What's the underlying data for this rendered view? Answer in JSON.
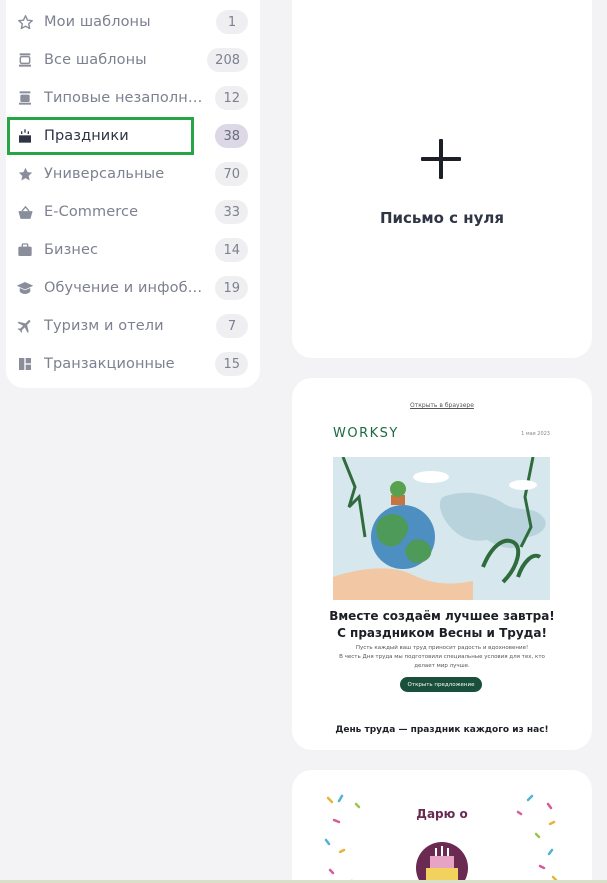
{
  "sidebar": {
    "items": [
      {
        "label": "Мои шаблоны",
        "count": "1",
        "icon": "star-outline-icon"
      },
      {
        "label": "Все шаблоны",
        "count": "208",
        "icon": "layers-icon"
      },
      {
        "label": "Типовые незаполнен...",
        "count": "12",
        "icon": "blank-template-icon"
      },
      {
        "label": "Праздники",
        "count": "38",
        "icon": "cake-icon"
      },
      {
        "label": "Универсальные",
        "count": "70",
        "icon": "star-icon"
      },
      {
        "label": "E-Commerce",
        "count": "33",
        "icon": "basket-icon"
      },
      {
        "label": "Бизнес",
        "count": "14",
        "icon": "briefcase-icon"
      },
      {
        "label": "Обучение и инфобиз...",
        "count": "19",
        "icon": "graduation-cap-icon"
      },
      {
        "label": "Туризм и отели",
        "count": "7",
        "icon": "airplane-icon"
      },
      {
        "label": "Транзакционные",
        "count": "15",
        "icon": "layout-icon"
      }
    ],
    "active_index": 3,
    "highlight_color": "#27a545"
  },
  "new_letter": {
    "label": "Письмо с нуля",
    "icon": "plus-icon"
  },
  "template_preview": {
    "open_link": "Открыть в браузере",
    "logo": "WORKSY",
    "date": "1 мая 2023",
    "headline_line1": "Вместе создаём лучшее завтра!",
    "headline_line2": "С праздником Весны и Труда!",
    "text_line1": "Пусть каждый ваш труд приносит радость и вдохновение!",
    "text_line2": "В честь Дня труда мы подготовили специальные условия для тех, кто",
    "text_line3": "делает мир лучше.",
    "button": "Открыть предложение",
    "footer_heading": "День труда — праздник каждого из нас!"
  },
  "template_preview2": {
    "title": "Дарю о"
  },
  "colors": {
    "accent_green": "#1a4f3c",
    "logo_green": "#1a6b45",
    "text_dark": "#2f3545",
    "muted": "#7d8190"
  }
}
